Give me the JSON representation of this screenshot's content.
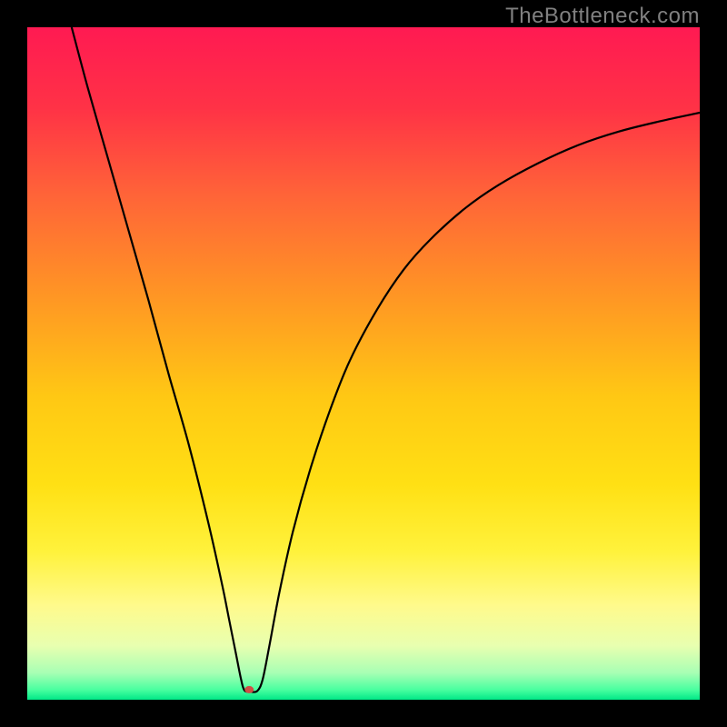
{
  "watermark": "TheBottleneck.com",
  "chart_data": {
    "type": "line",
    "title": "",
    "xlabel": "",
    "ylabel": "",
    "xlim": [
      0,
      100
    ],
    "ylim": [
      0,
      100
    ],
    "gradient_stops": [
      {
        "offset": 0.0,
        "color": "#ff1a52"
      },
      {
        "offset": 0.12,
        "color": "#ff3246"
      },
      {
        "offset": 0.25,
        "color": "#ff6438"
      },
      {
        "offset": 0.4,
        "color": "#ff9624"
      },
      {
        "offset": 0.55,
        "color": "#ffc814"
      },
      {
        "offset": 0.68,
        "color": "#ffe014"
      },
      {
        "offset": 0.78,
        "color": "#fff23c"
      },
      {
        "offset": 0.86,
        "color": "#fffa8c"
      },
      {
        "offset": 0.92,
        "color": "#e8ffb0"
      },
      {
        "offset": 0.96,
        "color": "#a8ffb4"
      },
      {
        "offset": 0.985,
        "color": "#4affa0"
      },
      {
        "offset": 1.0,
        "color": "#00e887"
      }
    ],
    "series": [
      {
        "name": "bottleneck-curve",
        "color": "#000000",
        "points": [
          {
            "x": 6.6,
            "y": 100.0
          },
          {
            "x": 9.0,
            "y": 91.0
          },
          {
            "x": 12.0,
            "y": 80.5
          },
          {
            "x": 15.0,
            "y": 70.0
          },
          {
            "x": 18.0,
            "y": 59.5
          },
          {
            "x": 21.0,
            "y": 48.5
          },
          {
            "x": 24.0,
            "y": 38.0
          },
          {
            "x": 27.0,
            "y": 26.0
          },
          {
            "x": 29.0,
            "y": 17.0
          },
          {
            "x": 30.0,
            "y": 12.0
          },
          {
            "x": 31.0,
            "y": 7.0
          },
          {
            "x": 31.8,
            "y": 3.0
          },
          {
            "x": 32.3,
            "y": 1.4
          },
          {
            "x": 33.2,
            "y": 1.2
          },
          {
            "x": 34.2,
            "y": 1.3
          },
          {
            "x": 35.0,
            "y": 3.0
          },
          {
            "x": 36.0,
            "y": 8.0
          },
          {
            "x": 37.5,
            "y": 16.0
          },
          {
            "x": 39.5,
            "y": 25.0
          },
          {
            "x": 42.0,
            "y": 34.0
          },
          {
            "x": 45.0,
            "y": 43.0
          },
          {
            "x": 48.0,
            "y": 50.5
          },
          {
            "x": 52.0,
            "y": 58.0
          },
          {
            "x": 56.0,
            "y": 64.0
          },
          {
            "x": 60.0,
            "y": 68.5
          },
          {
            "x": 65.0,
            "y": 73.0
          },
          {
            "x": 70.0,
            "y": 76.5
          },
          {
            "x": 76.0,
            "y": 79.8
          },
          {
            "x": 82.0,
            "y": 82.5
          },
          {
            "x": 88.0,
            "y": 84.5
          },
          {
            "x": 94.0,
            "y": 86.0
          },
          {
            "x": 100.0,
            "y": 87.3
          }
        ]
      }
    ],
    "marker": {
      "x": 33.0,
      "y": 1.5,
      "rx": 5,
      "ry": 4,
      "fill": "#cf4e45"
    }
  }
}
